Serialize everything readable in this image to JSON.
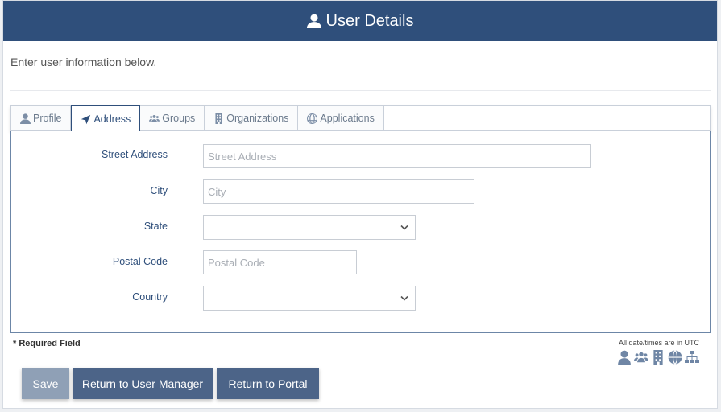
{
  "header": {
    "title": "User Details",
    "icon": "user-icon"
  },
  "intro_text": "Enter user information below.",
  "tabs": [
    {
      "label": "Profile",
      "icon": "user-icon",
      "active": false
    },
    {
      "label": "Address",
      "icon": "location-arrow-icon",
      "active": true
    },
    {
      "label": "Groups",
      "icon": "users-icon",
      "active": false
    },
    {
      "label": "Organizations",
      "icon": "building-icon",
      "active": false
    },
    {
      "label": "Applications",
      "icon": "globe-icon",
      "active": false
    }
  ],
  "form": {
    "street": {
      "label": "Street Address",
      "placeholder": "Street Address",
      "value": ""
    },
    "city": {
      "label": "City",
      "placeholder": "City",
      "value": ""
    },
    "state": {
      "label": "State",
      "value": ""
    },
    "postal": {
      "label": "Postal Code",
      "placeholder": "Postal Code",
      "value": ""
    },
    "country": {
      "label": "Country",
      "value": ""
    }
  },
  "footer": {
    "required_note": "* Required Field",
    "utc_note": "All date/times are in UTC",
    "icons": [
      "user-icon",
      "users-icon",
      "building-icon",
      "globe-icon",
      "sitemap-icon"
    ]
  },
  "buttons": {
    "save": "Save",
    "return_user_manager": "Return to User Manager",
    "return_portal": "Return to Portal"
  },
  "colors": {
    "primary": "#2f4f7b",
    "button": "#4c6488",
    "button_disabled": "#8fa0b6"
  }
}
